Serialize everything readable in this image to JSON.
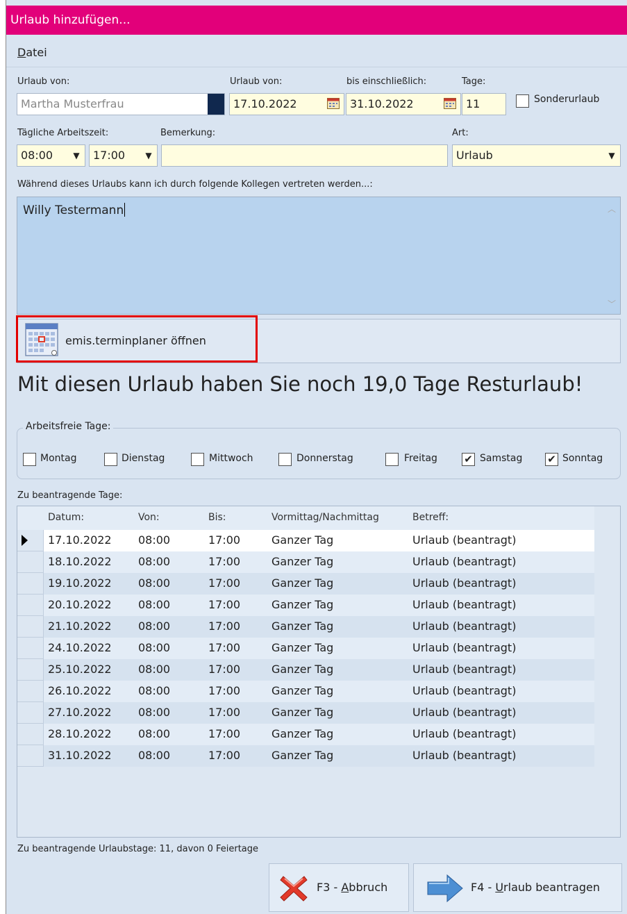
{
  "window": {
    "title": "Urlaub hinzufügen..."
  },
  "menu": {
    "datei": "Datei"
  },
  "labels": {
    "urlaub_von_person": "Urlaub von:",
    "urlaub_von_datum": "Urlaub von:",
    "bis": "bis einschließlich:",
    "tage": "Tage:",
    "taegliche_arbeitszeit": "Tägliche Arbeitszeit:",
    "bemerkung": "Bemerkung:",
    "art": "Art:",
    "vertretung": "Während dieses Urlaubs kann ich durch folgende Kollegen vertreten werden...:"
  },
  "fields": {
    "person": "Martha Musterfrau",
    "von_datum": "17.10.2022",
    "bis_datum": "31.10.2022",
    "tage": "11",
    "sonderurlaub": "Sonderurlaub",
    "zeit_von": "08:00",
    "zeit_bis": "17:00",
    "bemerkung": "",
    "art": "Urlaub",
    "vertretung": "Willy Testermann"
  },
  "planer_button": "emis.terminplaner öffnen",
  "message": "Mit diesen Urlaub haben Sie noch 19,0 Tage Resturlaub!",
  "arbeitsfreie_tage": {
    "title": "Arbeitsfreie Tage:",
    "days": [
      {
        "label": "Montag",
        "checked": false
      },
      {
        "label": "Dienstag",
        "checked": false
      },
      {
        "label": "Mittwoch",
        "checked": false
      },
      {
        "label": "Donnerstag",
        "checked": false
      },
      {
        "label": "Freitag",
        "checked": false
      },
      {
        "label": "Samstag",
        "checked": true
      },
      {
        "label": "Sonntag",
        "checked": true
      }
    ]
  },
  "table": {
    "title": "Zu beantragende Tage:",
    "columns": [
      "Datum:",
      "Von:",
      "Bis:",
      "Vormittag/Nachmittag",
      "Betreff:"
    ],
    "rows": [
      [
        "17.10.2022",
        "08:00",
        "17:00",
        "Ganzer Tag",
        "Urlaub (beantragt)"
      ],
      [
        "18.10.2022",
        "08:00",
        "17:00",
        "Ganzer Tag",
        "Urlaub (beantragt)"
      ],
      [
        "19.10.2022",
        "08:00",
        "17:00",
        "Ganzer Tag",
        "Urlaub (beantragt)"
      ],
      [
        "20.10.2022",
        "08:00",
        "17:00",
        "Ganzer Tag",
        "Urlaub (beantragt)"
      ],
      [
        "21.10.2022",
        "08:00",
        "17:00",
        "Ganzer Tag",
        "Urlaub (beantragt)"
      ],
      [
        "24.10.2022",
        "08:00",
        "17:00",
        "Ganzer Tag",
        "Urlaub (beantragt)"
      ],
      [
        "25.10.2022",
        "08:00",
        "17:00",
        "Ganzer Tag",
        "Urlaub (beantragt)"
      ],
      [
        "26.10.2022",
        "08:00",
        "17:00",
        "Ganzer Tag",
        "Urlaub (beantragt)"
      ],
      [
        "27.10.2022",
        "08:00",
        "17:00",
        "Ganzer Tag",
        "Urlaub (beantragt)"
      ],
      [
        "28.10.2022",
        "08:00",
        "17:00",
        "Ganzer Tag",
        "Urlaub (beantragt)"
      ],
      [
        "31.10.2022",
        "08:00",
        "17:00",
        "Ganzer Tag",
        "Urlaub (beantragt)"
      ]
    ]
  },
  "footer": {
    "summary": "Zu beantragende Urlaubstage: 11, davon 0 Feiertage",
    "abbruch_prefix": "F3 - ",
    "abbruch_key": "A",
    "abbruch_rest": "bbruch",
    "beantragen_prefix": "F4 - ",
    "beantragen_key": "U",
    "beantragen_rest": "rlaub beantragen"
  },
  "colors": {
    "titlebar": "#e2007a",
    "window_bg": "#d9e4f1",
    "input_bg": "#fffde0",
    "notes_bg": "#b8d3ee",
    "highlight_box": "#e20000"
  }
}
